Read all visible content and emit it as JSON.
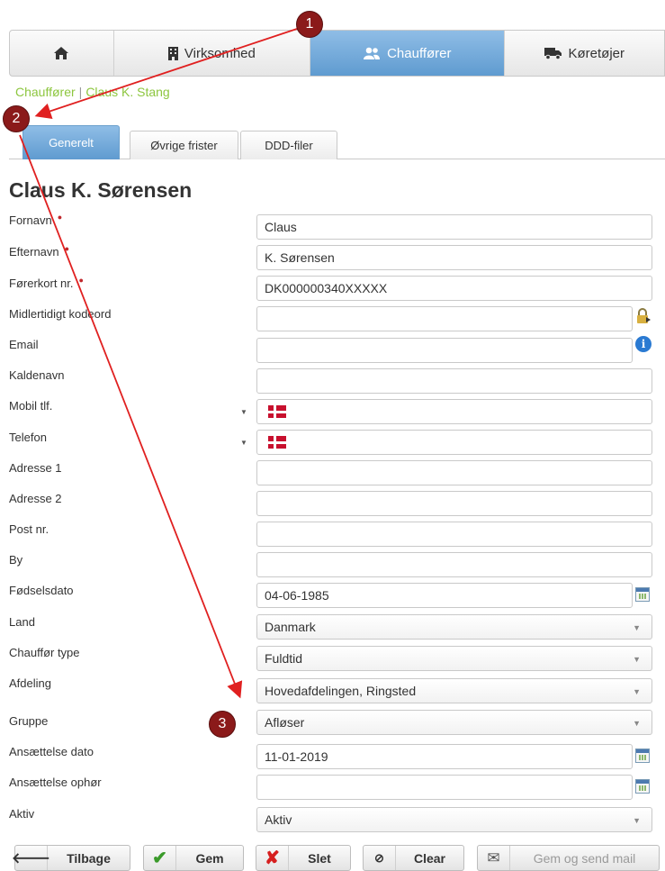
{
  "nav": {
    "home_icon": "home-icon",
    "items": [
      {
        "label": "Virksomhed",
        "icon": "building-icon"
      },
      {
        "label": "Chauffører",
        "icon": "users-icon"
      },
      {
        "label": "Køretøjer",
        "icon": "truck-icon"
      }
    ]
  },
  "breadcrumb": {
    "section": "Chauffører",
    "separator": "|",
    "current": "Claus K. Stang"
  },
  "tabs": [
    "Generelt",
    "Øvrige frister",
    "DDD-filer"
  ],
  "page_title": "Claus K. Sørensen",
  "form": {
    "fornavn": {
      "label": "Fornavn",
      "value": "Claus"
    },
    "efternavn": {
      "label": "Efternavn",
      "value": "K. Sørensen"
    },
    "forerkort": {
      "label": "Førerkort nr.",
      "value": "DK000000340XXXXX"
    },
    "kodeord": {
      "label": "Midlertidigt kodeord",
      "value": ""
    },
    "email": {
      "label": "Email",
      "value": ""
    },
    "kaldenavn": {
      "label": "Kaldenavn",
      "value": ""
    },
    "mobil": {
      "label": "Mobil tlf.",
      "value": ""
    },
    "telefon": {
      "label": "Telefon",
      "value": ""
    },
    "adresse1": {
      "label": "Adresse 1",
      "value": ""
    },
    "adresse2": {
      "label": "Adresse 2",
      "value": ""
    },
    "postnr": {
      "label": "Post nr.",
      "value": ""
    },
    "by": {
      "label": "By",
      "value": ""
    },
    "fodselsdato": {
      "label": "Fødselsdato",
      "value": "04-06-1985"
    },
    "land": {
      "label": "Land",
      "value": "Danmark"
    },
    "chauffortype": {
      "label": "Chauffør type",
      "value": "Fuldtid"
    },
    "afdeling": {
      "label": "Afdeling",
      "value": "Hovedafdelingen, Ringsted"
    },
    "gruppe": {
      "label": "Gruppe",
      "value": "Afløser"
    },
    "ansaettelse_dato": {
      "label": "Ansættelse dato",
      "value": "11-01-2019"
    },
    "ansaettelse_ophor": {
      "label": "Ansættelse ophør",
      "value": ""
    },
    "aktiv": {
      "label": "Aktiv",
      "value": "Aktiv"
    }
  },
  "buttons": {
    "tilbage": "Tilbage",
    "gem": "Gem",
    "slet": "Slet",
    "clear": "Clear",
    "gem_send": "Gem og send mail"
  },
  "annotations": [
    "1",
    "2",
    "3"
  ],
  "colors": {
    "accent": "#5f9bd0",
    "breadcrumb": "#8dc63f",
    "annotation": "#8b1a1a",
    "arrow": "#e02020"
  }
}
